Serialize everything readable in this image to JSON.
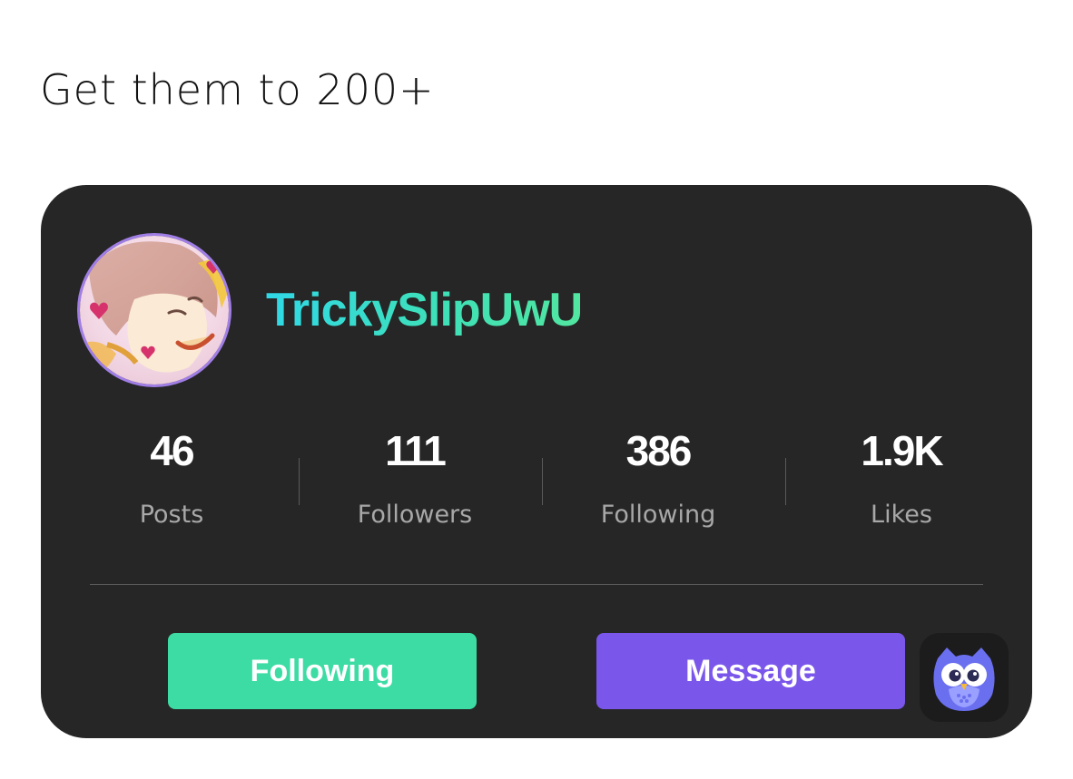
{
  "caption": "Get them to 200+",
  "profile": {
    "username": "TrickySlipUwU",
    "avatar_icon": "anime-avatar"
  },
  "stats": [
    {
      "value": "46",
      "label": "Posts"
    },
    {
      "value": "111",
      "label": "Followers"
    },
    {
      "value": "386",
      "label": "Following"
    },
    {
      "value": "1.9K",
      "label": "Likes"
    }
  ],
  "buttons": {
    "following_label": "Following",
    "message_label": "Message"
  },
  "app_icon": "owl-app-icon",
  "colors": {
    "card_bg": "#262626",
    "following_button": "#3ddca4",
    "message_button": "#7a57ea",
    "username_gradient_start": "#30d8e6",
    "username_gradient_end": "#52e6a0"
  }
}
